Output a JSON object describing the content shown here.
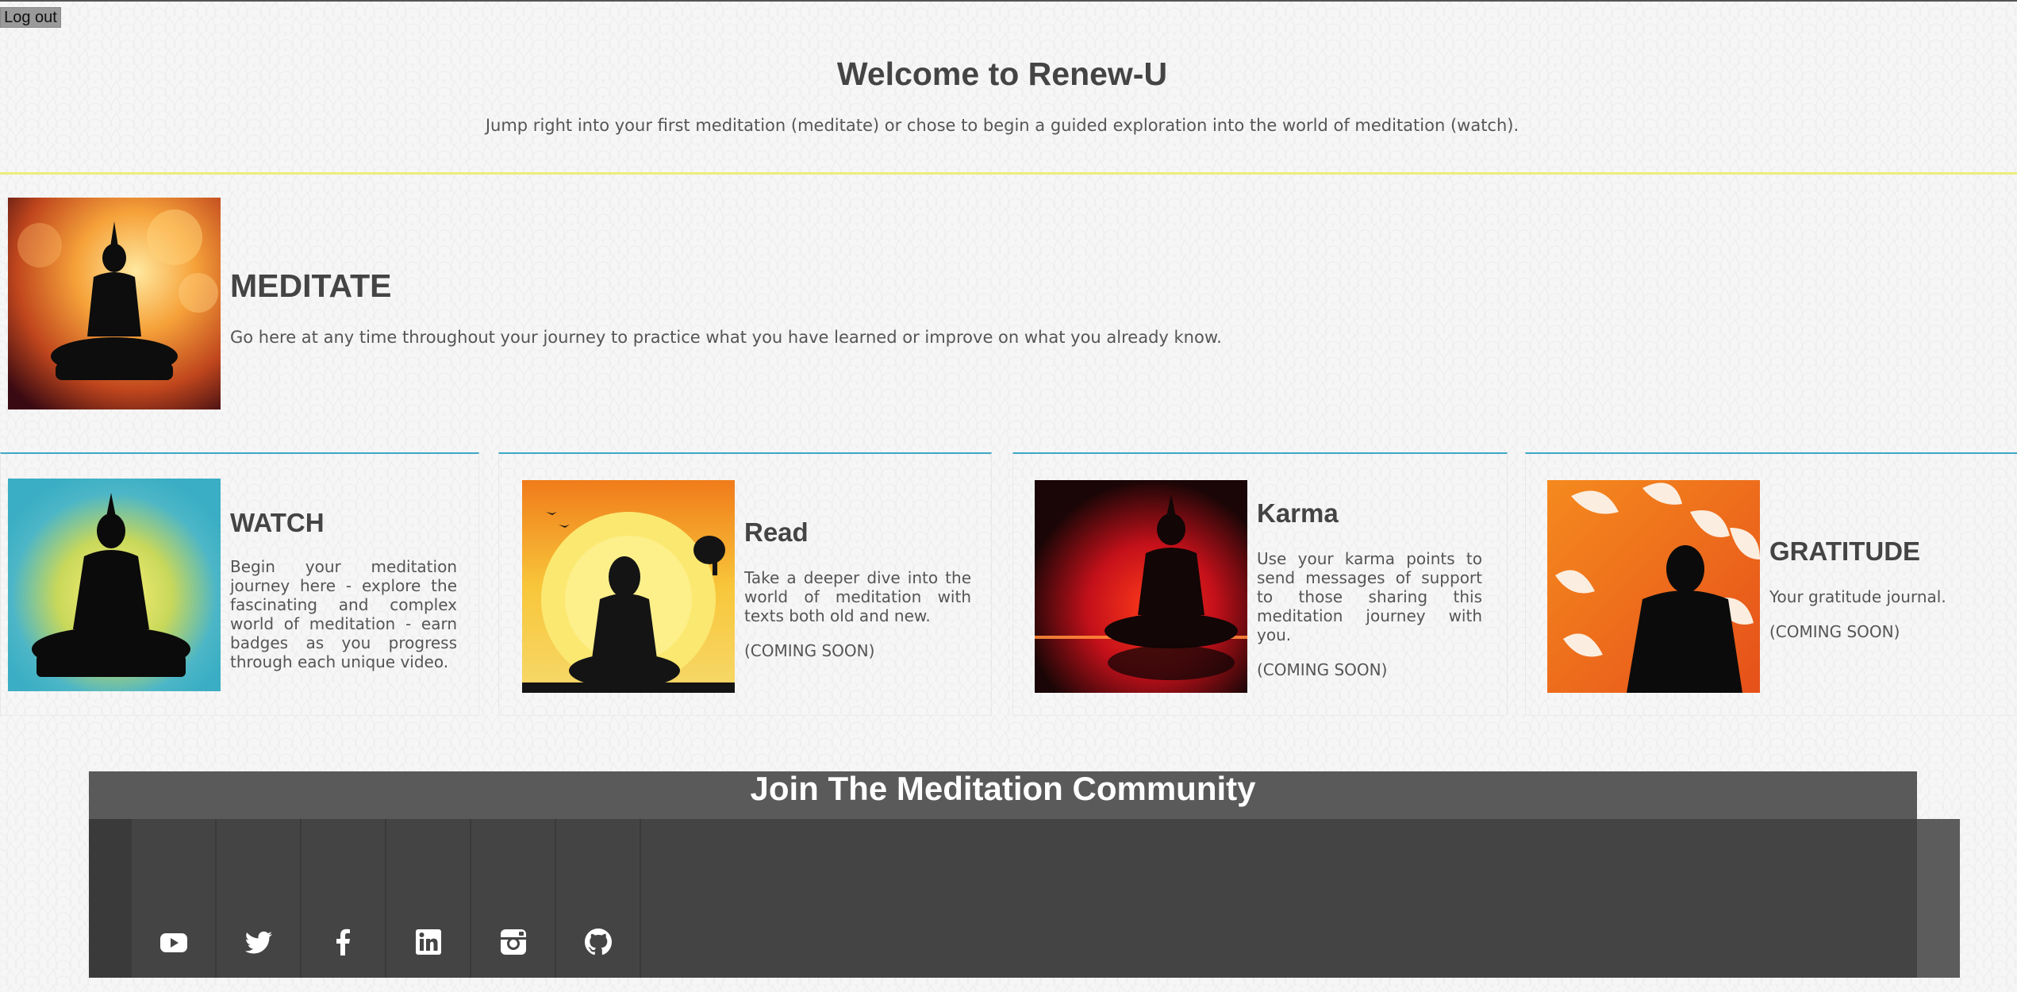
{
  "header": {
    "logout_label": "Log out",
    "title": "Welcome to Renew-U",
    "subtitle": "Jump right into your first meditation (meditate) or chose to begin a guided exploration into the world of meditation (watch)."
  },
  "meditate": {
    "title": "MEDITATE",
    "description": "Go here at any time throughout your journey to practice what you have learned or improve on what you already know."
  },
  "cards": [
    {
      "title": "WATCH",
      "description": "Begin your meditation journey here - explore the fascinating and complex world of meditation - earn badges as you progress through each unique video.",
      "status": ""
    },
    {
      "title": "Read",
      "description": "Take a deeper dive into the world of meditation with texts both old and new.",
      "status": "(COMING SOON)"
    },
    {
      "title": "Karma",
      "description": "Use your karma points to send messages of support to those sharing this meditation journey with you.",
      "status": "(COMING SOON)"
    },
    {
      "title": "GRATITUDE",
      "description": "Your gratitude journal.",
      "status": "(COMING SOON)"
    }
  ],
  "community": {
    "title": "Join The Meditation Community",
    "social_icons": [
      "youtube-icon",
      "twitter-icon",
      "facebook-icon",
      "linkedin-icon",
      "instagram-icon",
      "github-icon"
    ]
  },
  "colors": {
    "card_border": "#3ea7c6",
    "divider": "#eded7a",
    "footer_bg": "#444444"
  }
}
